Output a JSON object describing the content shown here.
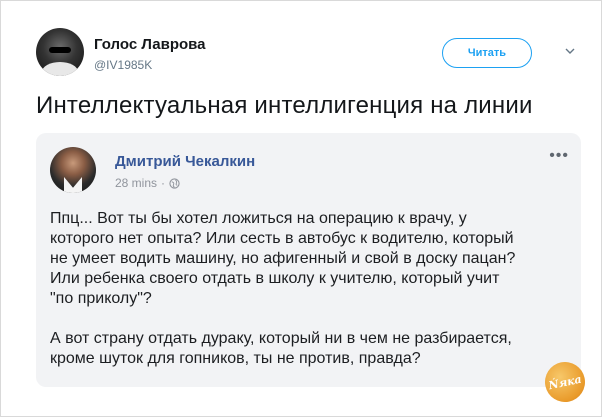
{
  "tweet": {
    "author_name": "Голос Лаврова",
    "author_handle": "@IV1985K",
    "follow_label": "Читать",
    "text": "Интеллектуальная интеллигенция на линии"
  },
  "quoted_post": {
    "author_name": "Дмитрий Чекалкин",
    "time": "28 mins",
    "separator": "·",
    "more": "•••",
    "text": "Ппц... Вот ты бы хотел ложиться на операцию к врачу, у\nкоторого нет опыта? Или сесть в автобус к водителю, который\nне умеет водить машину, но афигенный и свой в доску пацан?\nИли ребенка своего отдать в школу к учителю, который учит\n\"по приколу\"?\n\nА вот страну отдать дураку, который ни в чем не разбирается,\nкроме шуток для гопников, ты не против, правда?"
  },
  "watermark": {
    "text": "Ńяка"
  },
  "colors": {
    "twitter_blue": "#1da1f2",
    "facebook_name": "#385898",
    "quote_bg": "#f2f3f5"
  },
  "icons": {
    "chevron": "chevron-down-icon",
    "globe": "globe-icon",
    "more": "more-horizontal-icon"
  }
}
